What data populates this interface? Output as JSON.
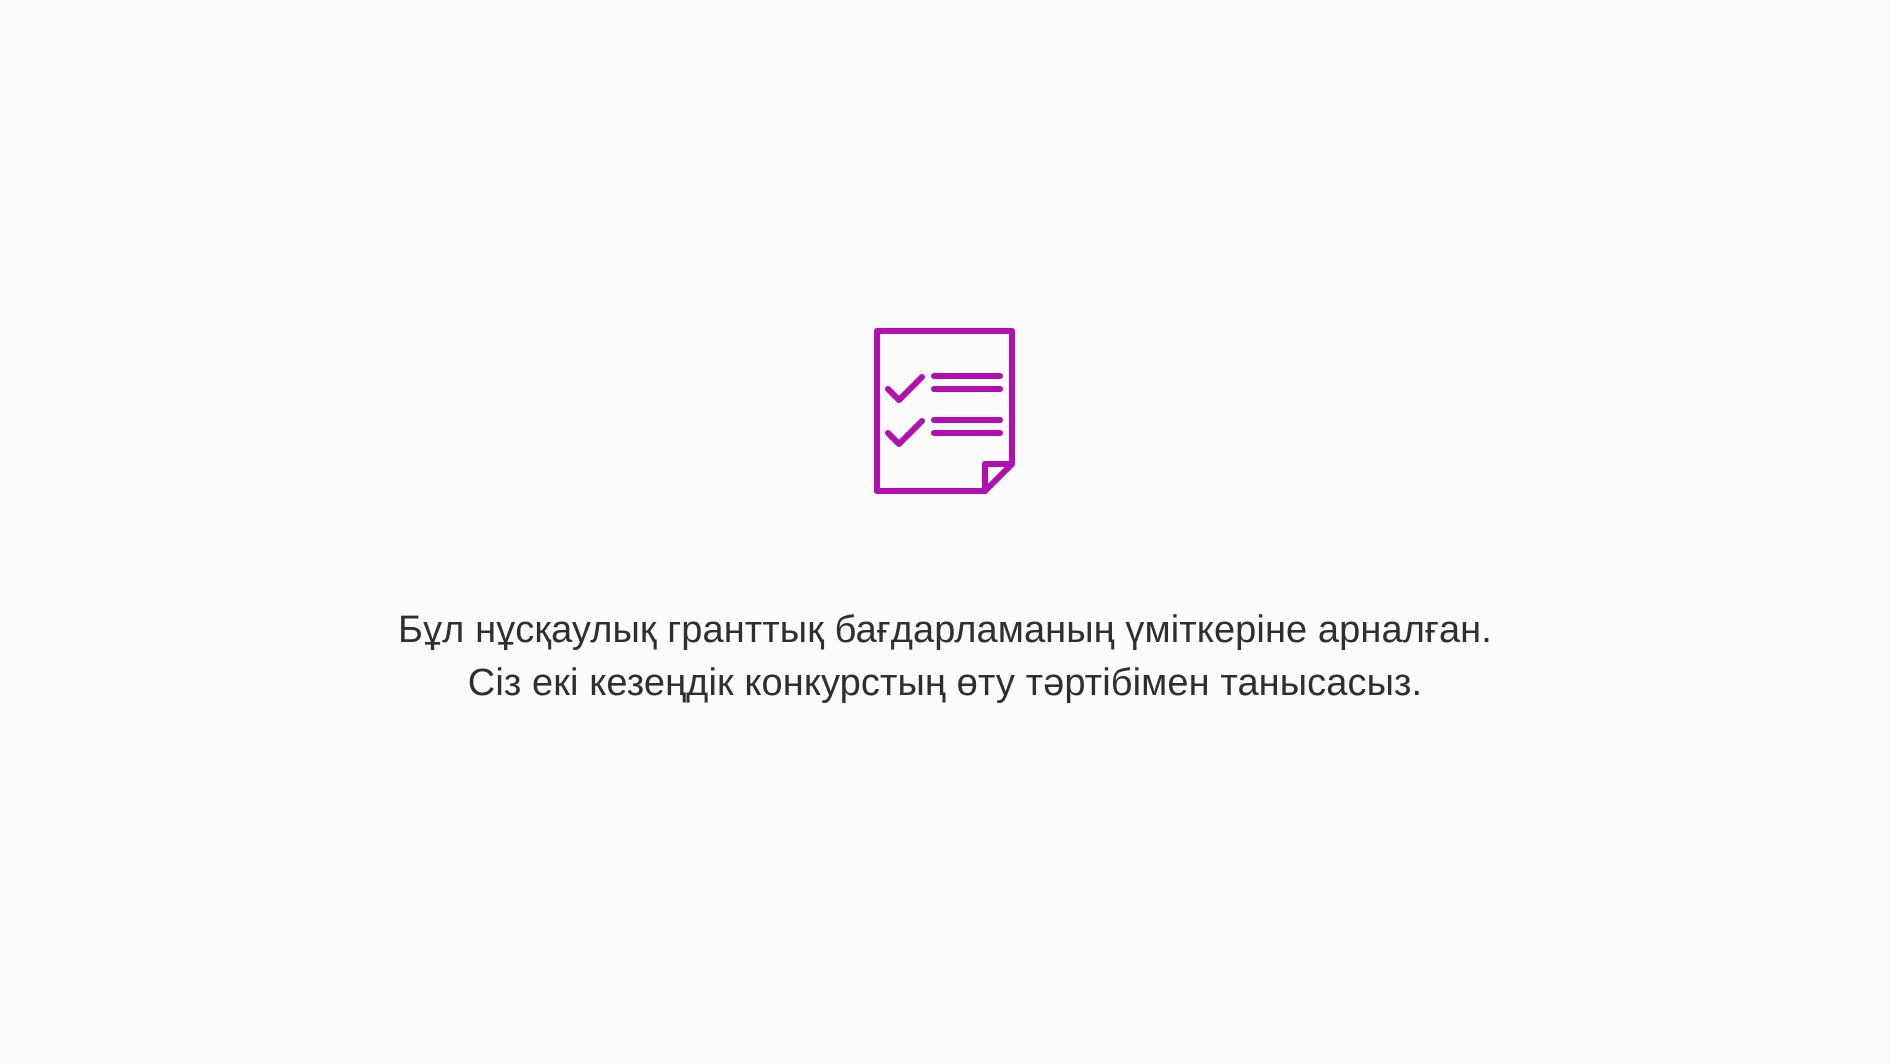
{
  "screen": {
    "background_color": "#fcfcfc",
    "text_color": "#2f2f33",
    "accent_color": "#b10fb1"
  },
  "icon": {
    "name": "checklist-document-icon"
  },
  "message": {
    "line1": "Бұл нұсқаулық гранттық бағдарламаның үміткеріне арналған.",
    "line2": "Сіз екі кезеңдік конкурстың өту тәртібімен танысасыз."
  }
}
